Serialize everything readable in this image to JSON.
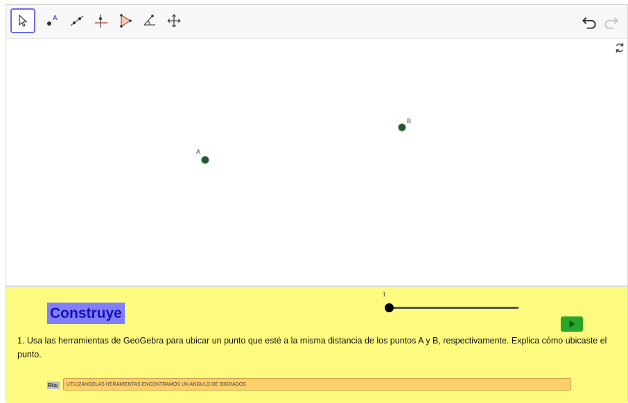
{
  "toolbar": {
    "tools": [
      {
        "name": "move-tool",
        "icon": "arrow-cursor-icon"
      },
      {
        "name": "point-tool",
        "icon": "point-A-icon"
      },
      {
        "name": "line-tool",
        "icon": "line-icon"
      },
      {
        "name": "perpendicular-line-tool",
        "icon": "perpendicular-icon"
      },
      {
        "name": "polygon-tool",
        "icon": "polygon-icon"
      },
      {
        "name": "angle-tool",
        "icon": "angle-icon"
      },
      {
        "name": "move-graphics-tool",
        "icon": "move-graphics-icon"
      }
    ],
    "undo_icon": "undo-icon",
    "redo_icon": "redo-icon"
  },
  "graphics": {
    "points": [
      {
        "label": "A"
      },
      {
        "label": "B"
      }
    ],
    "point_color": "#1e5a2a"
  },
  "panel": {
    "title": "Construye",
    "slider_value": "1",
    "question": "1. Usa las herramientas de GeoGebra para ubicar un punto que esté a la misma distancia de los puntos A y B, respectivamente. Explica cómo ubicaste el punto.",
    "answer_label": "Rta:",
    "answer_value": "UTILIZANDOLAS HERAMIENTAS ENCONTRAMOS UN ANGULO DE 90GRADOS",
    "background": "#fdfb7f",
    "title_bg": "#8080ff"
  }
}
